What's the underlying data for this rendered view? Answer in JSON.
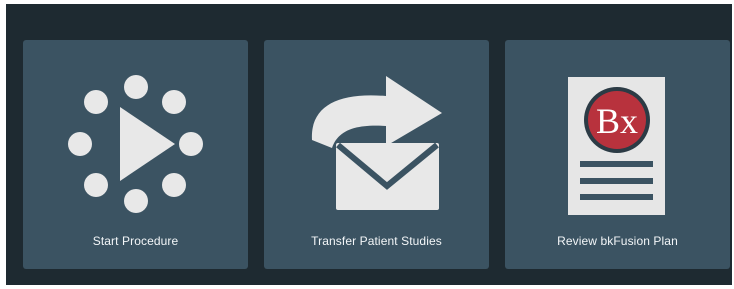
{
  "tiles": [
    {
      "label": "Start Procedure",
      "icon": "play-icon"
    },
    {
      "label": "Transfer Patient Studies",
      "icon": "mail-forward-icon"
    },
    {
      "label": "Review bkFusion Plan",
      "icon": "plan-document-icon",
      "badge_text": "Bx"
    }
  ],
  "colors": {
    "background": "#1e2a31",
    "tile": "#3b5362",
    "icon": "#e8e8e8",
    "badge": "#b8323d",
    "badge_ring": "#2c3b45"
  }
}
